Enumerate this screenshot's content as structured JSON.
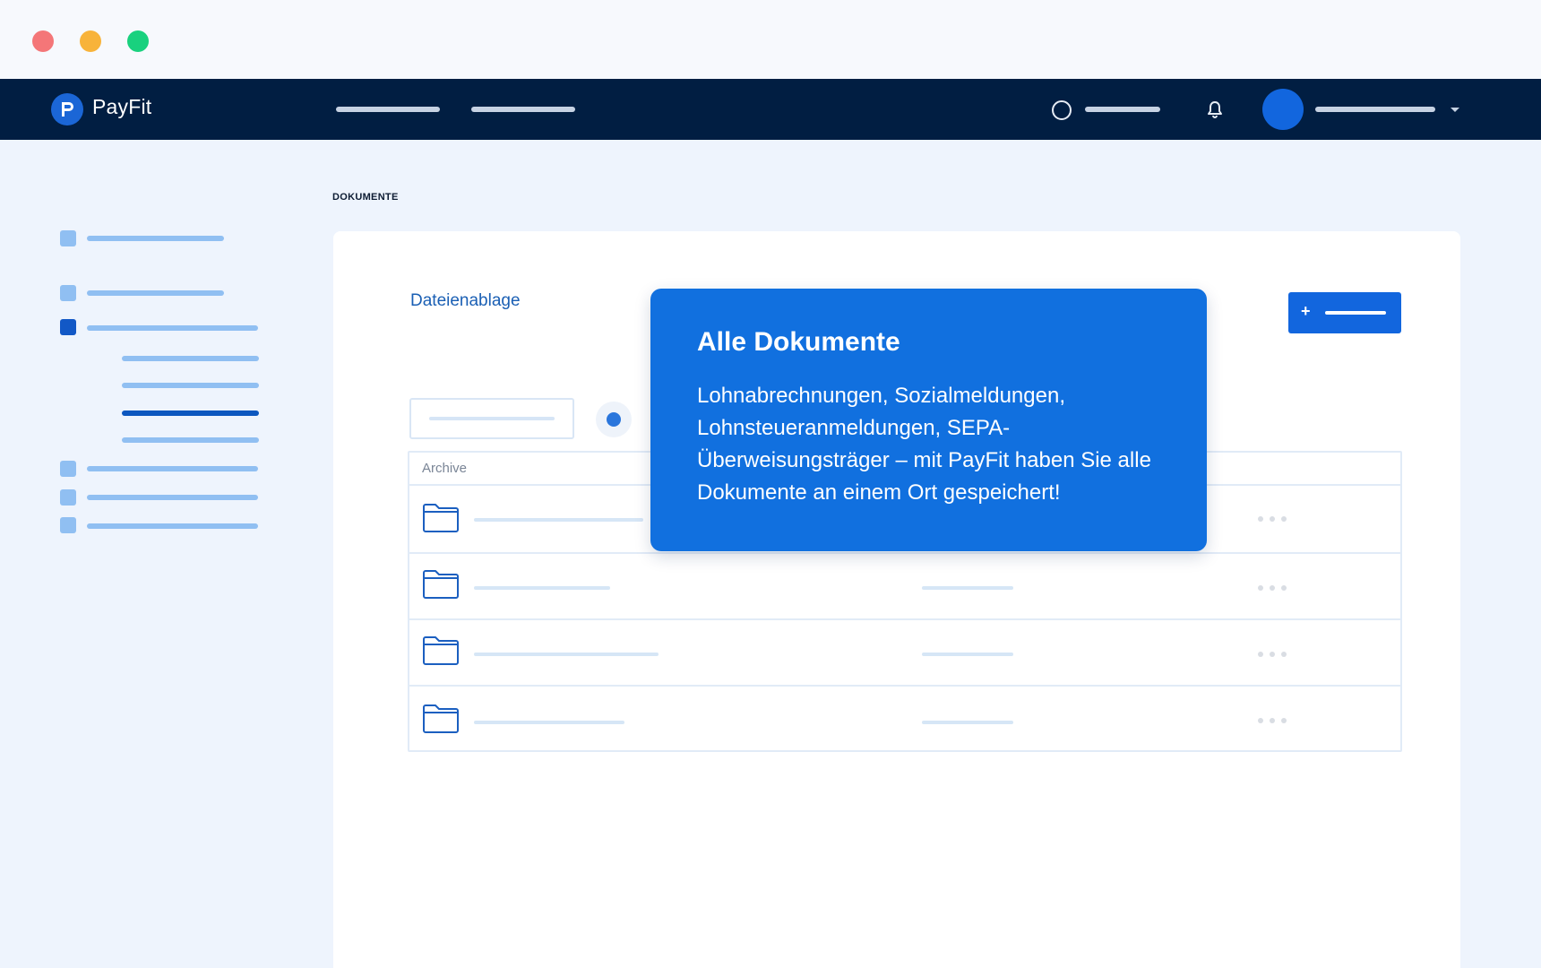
{
  "window": {
    "controls": [
      "close",
      "minimize",
      "maximize"
    ]
  },
  "topnav": {
    "brand": "PayFit",
    "logo_letter": "P",
    "icons": [
      "status-circle-icon",
      "bell-icon",
      "avatar",
      "chevron-down-icon"
    ]
  },
  "breadcrumb": "DOKUMENTE",
  "main": {
    "section_title": "Dateienablage",
    "add_button_label": "+",
    "table": {
      "column_header": "Archive",
      "rows": 4
    }
  },
  "tooltip": {
    "title": "Alle Dokumente",
    "body": "Lohnabrechnungen, Sozialmeldungen, Lohnsteueranmeldungen, SEPA-Überweisungsträger – mit PayFit haben Sie alle Dokumente an einem Ort gespeichert!"
  },
  "colors": {
    "nav_bg": "#011e42",
    "accent": "#1266de",
    "tooltip_bg": "#1170df",
    "page_bg": "#eef4fd"
  }
}
